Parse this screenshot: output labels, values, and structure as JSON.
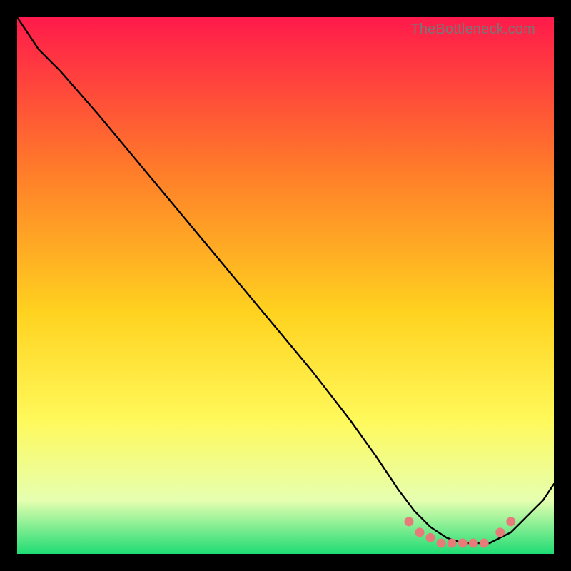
{
  "watermark": "TheBottleneck.com",
  "colors": {
    "gradient_top": "#ff1a4b",
    "gradient_mid1": "#ff7a2a",
    "gradient_mid2": "#ffd21f",
    "gradient_mid3": "#fff95a",
    "gradient_mid4": "#e6ffb0",
    "gradient_bottom": "#1fdc74",
    "curve": "#000000",
    "markers": "#e87a7a"
  },
  "chart_data": {
    "type": "line",
    "title": "",
    "xlabel": "",
    "ylabel": "",
    "xlim": [
      0,
      100
    ],
    "ylim": [
      0,
      100
    ],
    "grid": false,
    "legend": false,
    "series": [
      {
        "name": "bottleneck-curve",
        "x": [
          0,
          4,
          8,
          15,
          25,
          35,
          45,
          55,
          62,
          67,
          71,
          74,
          77,
          80,
          83,
          86,
          88,
          90,
          92,
          94,
          96,
          98,
          100
        ],
        "y": [
          100,
          94,
          90,
          82,
          70,
          58,
          46,
          34,
          25,
          18,
          12,
          8,
          5,
          3,
          2,
          2,
          2,
          3,
          4,
          6,
          8,
          10,
          13
        ]
      }
    ],
    "markers": {
      "name": "highlight-points",
      "x": [
        73,
        75,
        77,
        79,
        81,
        83,
        85,
        87,
        90,
        92
      ],
      "y": [
        6,
        4,
        3,
        2,
        2,
        2,
        2,
        2,
        4,
        6
      ]
    },
    "annotations": []
  }
}
